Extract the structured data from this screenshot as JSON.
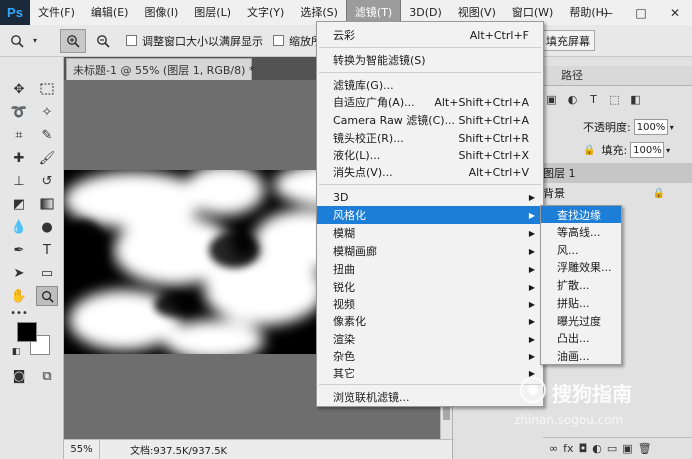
{
  "app": {
    "logo": "Ps",
    "menus": [
      "文件(F)",
      "编辑(E)",
      "图像(I)",
      "图层(L)",
      "文字(Y)",
      "选择(S)",
      "滤镜(T)",
      "3D(D)",
      "视图(V)",
      "窗口(W)",
      "帮助(H)"
    ],
    "active_menu": "滤镜(T)",
    "window_buttons": [
      "—",
      "□",
      "✕"
    ]
  },
  "options_bar": {
    "zoom_tool_icon": "zoom-icon",
    "resize_window_label": "调整窗口大小以满屏显示",
    "zoom_all_label": "缩放所有窗",
    "fill_screen_button": "填充屏幕"
  },
  "document": {
    "tab_title": "未标题-1 @ 55% (图层 1, RGB/8) *",
    "close_glyph": "✕",
    "zoom": "55%",
    "doc_size": "文档:937.5K/937.5K"
  },
  "panels": {
    "path_tab": "路径",
    "opacity_label": "不透明度:",
    "opacity_value": "100%",
    "fill_label": "填充:",
    "fill_value": "100%",
    "layers": [
      {
        "name": "图层 1",
        "active": true
      },
      {
        "name": "背景",
        "active": false
      }
    ],
    "bottom_icons": [
      "∞",
      "fx",
      "◘",
      "◐",
      "▭",
      "▣",
      "🗑"
    ]
  },
  "filter_menu": {
    "items": [
      {
        "label": "云彩",
        "shortcut": "Alt+Ctrl+F",
        "submenu": false
      },
      {
        "label": "转换为智能滤镜(S)",
        "shortcut": "",
        "submenu": false
      },
      {
        "label": "滤镜库(G)...",
        "shortcut": "",
        "submenu": false
      },
      {
        "label": "自适应广角(A)...",
        "shortcut": "Alt+Shift+Ctrl+A",
        "submenu": false
      },
      {
        "label": "Camera Raw 滤镜(C)...",
        "shortcut": "Shift+Ctrl+A",
        "submenu": false
      },
      {
        "label": "镜头校正(R)...",
        "shortcut": "Shift+Ctrl+R",
        "submenu": false
      },
      {
        "label": "液化(L)...",
        "shortcut": "Shift+Ctrl+X",
        "submenu": false
      },
      {
        "label": "消失点(V)...",
        "shortcut": "Alt+Ctrl+V",
        "submenu": false
      },
      {
        "label": "3D",
        "shortcut": "",
        "submenu": true
      },
      {
        "label": "风格化",
        "shortcut": "",
        "submenu": true,
        "highlight": true
      },
      {
        "label": "模糊",
        "shortcut": "",
        "submenu": true
      },
      {
        "label": "模糊画廊",
        "shortcut": "",
        "submenu": true
      },
      {
        "label": "扭曲",
        "shortcut": "",
        "submenu": true
      },
      {
        "label": "锐化",
        "shortcut": "",
        "submenu": true
      },
      {
        "label": "视频",
        "shortcut": "",
        "submenu": true
      },
      {
        "label": "像素化",
        "shortcut": "",
        "submenu": true
      },
      {
        "label": "渲染",
        "shortcut": "",
        "submenu": true
      },
      {
        "label": "杂色",
        "shortcut": "",
        "submenu": true
      },
      {
        "label": "其它",
        "shortcut": "",
        "submenu": true
      },
      {
        "label": "浏览联机滤镜...",
        "shortcut": "",
        "submenu": false
      }
    ],
    "submenu_glyph": "▶"
  },
  "stylize_submenu": {
    "items": [
      "查找边缘",
      "等高线...",
      "风...",
      "浮雕效果...",
      "扩散...",
      "拼贴...",
      "曝光过度",
      "凸出...",
      "油画..."
    ],
    "highlighted": "查找边缘"
  },
  "watermark": {
    "title": "搜狗指南",
    "url": "zhinan.sogou.com"
  },
  "colors": {
    "highlight": "#1c7ed6",
    "canvas_bg": "#6e6e6e",
    "workspace": "#535353"
  }
}
